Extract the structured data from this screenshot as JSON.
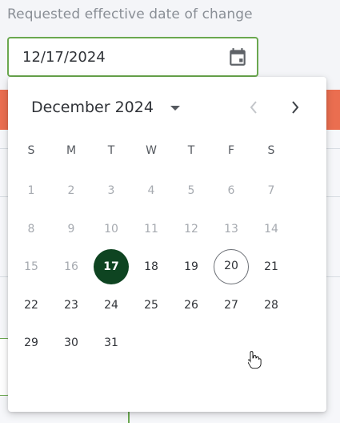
{
  "field": {
    "label": "Requested effective date of change",
    "value": "12/17/2024",
    "icon": "calendar-icon"
  },
  "calendar": {
    "month_label": "December 2024",
    "weekdays": [
      "S",
      "M",
      "T",
      "W",
      "T",
      "F",
      "S"
    ],
    "weeks": [
      [
        "1",
        "2",
        "3",
        "4",
        "5",
        "6",
        "7"
      ],
      [
        "8",
        "9",
        "10",
        "11",
        "12",
        "13",
        "14"
      ],
      [
        "15",
        "16",
        "17",
        "18",
        "19",
        "20",
        "21"
      ],
      [
        "22",
        "23",
        "24",
        "25",
        "26",
        "27",
        "28"
      ],
      [
        "29",
        "30",
        "31"
      ]
    ],
    "selected_day": "17",
    "hovered_day": "20",
    "colors": {
      "selected_bg": "#0e4421",
      "input_border": "#6aa84f",
      "header_band": "#ea6e50"
    }
  }
}
